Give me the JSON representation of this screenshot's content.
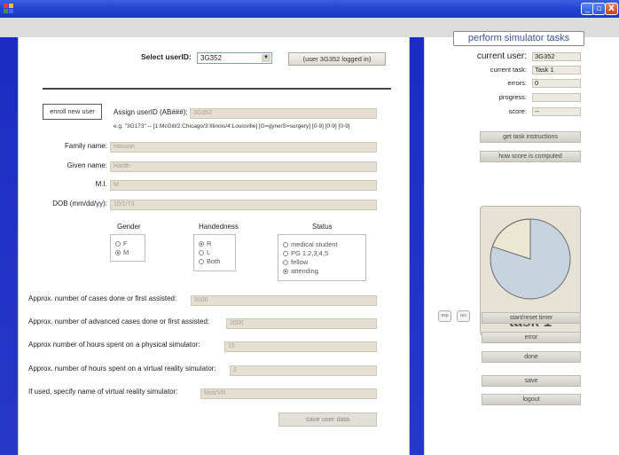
{
  "window": {
    "buttons": {
      "minimize": "_",
      "maximize": "▫",
      "close": "X"
    }
  },
  "enroll": {
    "select_user_label": "Select userID:",
    "select_user_value": "3G352",
    "logged_in_text": "(user 3G352 logged in)",
    "enroll_button": "enroll new user",
    "assign_label": "Assign userID (AB###):",
    "assign_value": "3G352",
    "hint": "e.g. \"3G173\"  --  [1:McGill/2:Chicago/3:Illinois/4:Louisville] [G=gyne/S=surgery] [0-9] [0-9] [0-9]",
    "family_label": "Family name:",
    "family_value": "Hasson",
    "given_label": "Given name:",
    "given_value": "Harith",
    "mi_label": "M.I.",
    "mi_value": "M",
    "dob_label": "DOB (mm/dd/yy):",
    "dob_value": "10/1/73",
    "gender": {
      "title": "Gender",
      "options": [
        "F",
        "M"
      ],
      "selected": "M"
    },
    "handedness": {
      "title": "Handedness",
      "options": [
        "R",
        "L",
        "Both"
      ],
      "selected": "R"
    },
    "status": {
      "title": "Status",
      "options": [
        "medical student",
        "PG 1,2,3,4,5",
        "fellow",
        "attending"
      ],
      "selected": "attending"
    },
    "cases_label": "Approx. number of cases done or first assisted:",
    "cases_value": "5000",
    "adv_label": "Approx. number of advanced cases done or first assisted:",
    "adv_value": "2000",
    "phys_label": "Approx number of hours spent on a physical simulator:",
    "phys_value": "15",
    "vr_label": "Approx. number of hours spent on a virtual reality simulator:",
    "vr_value": "2",
    "vrname_label": "If used, specify name of virtual reality simulator:",
    "vrname_value": "Mist/VR",
    "save_button": "save user data"
  },
  "simulator": {
    "heading": "perform simulator tasks",
    "current_user_label": "current user:",
    "current_user_value": "3G352",
    "current_task_label": "current task:",
    "current_task_value": "Task 1",
    "errors_label": "errors:",
    "errors_value": "0",
    "progress_label": "progress:",
    "progress_value": "",
    "score_label": "score:",
    "score_value": "--",
    "instructions_button": "get task instructions",
    "how_score_button": "how score is computed",
    "task_label": "task 1",
    "timer_fraction": 0.2,
    "exp_button": "exp",
    "rec_button": "rec",
    "timer_button": "start/reset timer",
    "error_button": "error",
    "done_button": "done",
    "save_button": "save",
    "logout_button": "logout",
    "colors": {
      "pie_filled": "#ebe7d3",
      "pie_empty": "#c8d3e0",
      "pie_border": "#6a6a6a"
    }
  }
}
